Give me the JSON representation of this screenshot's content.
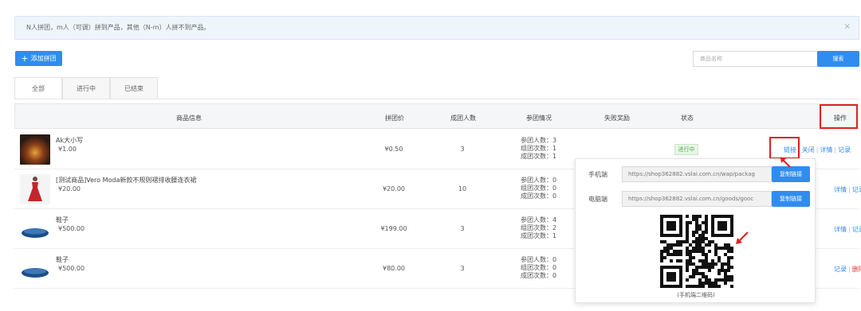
{
  "notice": {
    "text": "N人拼团，m人（可调）拼到产品，其他（N-m）人拼不到产品。"
  },
  "toolbar": {
    "add_label": "添加拼团",
    "search_placeholder": "商品名称",
    "search_label": "搜索"
  },
  "tabs": [
    {
      "label": "全部"
    },
    {
      "label": "进行中"
    },
    {
      "label": "已结束"
    }
  ],
  "table": {
    "headers": {
      "product": "商品信息",
      "price": "拼团价",
      "size": "成团人数",
      "participation": "参团情况",
      "reward": "失败奖励",
      "status": "状态",
      "ops": "操作"
    },
    "rows": [
      {
        "name": "Ak大小写",
        "price": "¥1.00",
        "group_price": "¥0.50",
        "size": "3",
        "stats": [
          "参团人数：3",
          "组团次数：1",
          "成团次数：1"
        ],
        "status": "进行中",
        "actions": [
          "链接",
          "关闭",
          "详情",
          "记录"
        ]
      },
      {
        "name": "[测试商品]Vero Moda新款不规则褶排收腰连衣裙",
        "price": "¥20.00",
        "group_price": "¥20.00",
        "size": "10",
        "stats": [
          "参团人数：0",
          "组团次数：0",
          "成团次数：0"
        ],
        "status": "",
        "actions": [
          "详情",
          "记录"
        ]
      },
      {
        "name": "鞋子",
        "price": "¥500.00",
        "group_price": "¥199.00",
        "size": "3",
        "stats": [
          "参团人数：4",
          "组团次数：2",
          "成团次数：1"
        ],
        "status": "",
        "actions": [
          "详情",
          "记录"
        ]
      },
      {
        "name": "鞋子",
        "price": "¥500.00",
        "group_price": "¥80.00",
        "size": "3",
        "stats": [
          "参团人数：0",
          "组团次数：0",
          "成团次数：0"
        ],
        "status": "",
        "actions": [
          "记录",
          "删除"
        ]
      }
    ]
  },
  "popup": {
    "mobile_label": "手机端",
    "mobile_url": "https://shop362882.vslai.com.cn/wap/packag",
    "pc_label": "电脑端",
    "pc_url": "https://shop362882.vslai.com.cn/goods/gooc",
    "copy_label": "复制链接",
    "qr_caption": "(手机端二维码)"
  },
  "colors": {
    "accent": "#2f8df0",
    "highlight": "#e02020",
    "status_green": "#4caf50"
  }
}
